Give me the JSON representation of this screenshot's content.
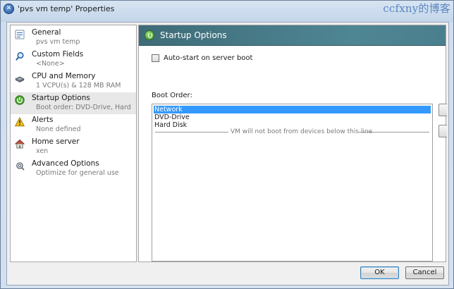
{
  "window": {
    "title": "'pvs vm temp' Properties",
    "watermark": "ccfxny的博客"
  },
  "nav": {
    "items": [
      {
        "title": "General",
        "subtitle": "pvs vm temp",
        "icon": "info-icon",
        "selected": false
      },
      {
        "title": "Custom Fields",
        "subtitle": "<None>",
        "icon": "search-icon",
        "selected": false
      },
      {
        "title": "CPU and Memory",
        "subtitle": "1 VCPU(s) & 128 MB RAM",
        "icon": "cpu-icon",
        "selected": false
      },
      {
        "title": "Startup Options",
        "subtitle": "Boot order: DVD-Drive, Hard D...",
        "icon": "power-icon",
        "selected": true
      },
      {
        "title": "Alerts",
        "subtitle": "None defined",
        "icon": "warning-icon",
        "selected": false
      },
      {
        "title": "Home server",
        "subtitle": "xen",
        "icon": "home-icon",
        "selected": false
      },
      {
        "title": "Advanced Options",
        "subtitle": "Optimize for general use",
        "icon": "advanced-options-icon",
        "selected": false
      }
    ]
  },
  "panel": {
    "title": "Startup Options",
    "autostart_label": "Auto-start on server boot",
    "autostart_checked": false,
    "boot_order_label": "Boot Order:",
    "boot_items": [
      "Network",
      "DVD-Drive",
      "Hard Disk"
    ],
    "selected_boot_item": "Network",
    "divider_text": "VM will not boot from devices below this line"
  },
  "buttons": {
    "ok": "OK",
    "cancel": "Cancel"
  },
  "colors": {
    "header_accent": "#4f8694",
    "selection": "#3399ff"
  }
}
